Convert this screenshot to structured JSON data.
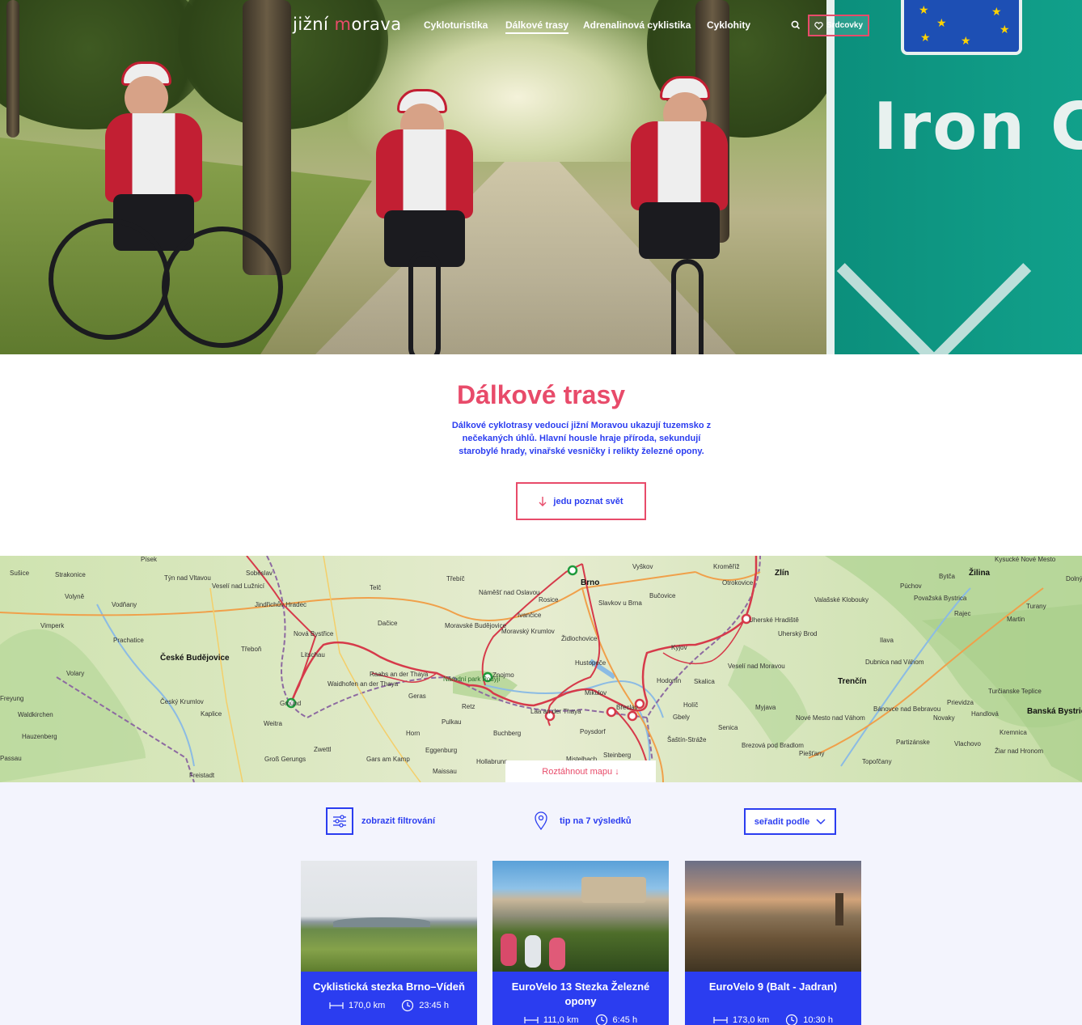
{
  "nav": {
    "logo_prefix": "jižní ",
    "logo_m": "m",
    "logo_suffix": "orava",
    "links": [
      "Cykloturistika",
      "Dálkové trasy",
      "Adrenalinová cyklistika",
      "Cyklohity"
    ],
    "active_index": 1,
    "favorites_label": "Srdcovky"
  },
  "hero": {
    "sign_text": "Iron Cu"
  },
  "intro": {
    "title": "Dálkové trasy",
    "text": "Dálkové cyklotrasy vedoucí jižní Moravou ukazují tuzemsko z nečekaných úhlů. Hlavní housle hraje příroda, sekundují starobylé hrady, vinařské vesničky i relikty železné opony.",
    "cta_label": "jedu poznat svět"
  },
  "map": {
    "toggle_label": "Roztáhnout mapu ↓",
    "cities_major": [
      "České Budějovice",
      "Brno",
      "Zlín",
      "Žilina",
      "Trenčín",
      "Banská Bystric"
    ],
    "places": [
      "Písek",
      "Strakonice",
      "Sušice",
      "Týn nad Vltavou",
      "Veselí nad Lužnicí",
      "Soběslav",
      "Jindřichův Hradec",
      "Volyně",
      "Vodňany",
      "Vimperk",
      "Prachatice",
      "Třeboň",
      "Nová Bystřice",
      "Litschau",
      "Telč",
      "Třebíč",
      "Dačice",
      "Moravské Budějovice",
      "Náměšť nad Oslavou",
      "Moravský Krumlov",
      "Rosice",
      "Ivančice",
      "Vyškov",
      "Slavkov u Brna",
      "Židlochovice",
      "Hustopeče",
      "Mikulov",
      "Břeclav",
      "Hodonín",
      "Kyjov",
      "Bučovice",
      "Kroměříž",
      "Otrokovice",
      "Uherské Hradiště",
      "Uherský Brod",
      "Veselí nad Moravou",
      "Holíč",
      "Skalica",
      "Senica",
      "Myjava",
      "Gbely",
      "Šaštín-Stráže",
      "Poysdorf",
      "Mistelbach",
      "Hollabrunn",
      "Laa an der Thaya",
      "Retz",
      "Znojmo",
      "Pulkau",
      "Horn",
      "Zwettl",
      "Eggenburg",
      "Gars am Kamp",
      "Maissau",
      "Geras",
      "Raabs an der Thaya",
      "Waidhofen an der Thaya",
      "Gmünd",
      "Weitra",
      "Groß Gerungs",
      "Freistadt",
      "Kaplice",
      "Český Krumlov",
      "Volary",
      "Waldkirchen",
      "Hauzenberg",
      "Passau",
      "Freyung",
      "Brezová pod Bradlom",
      "Nové Mesto nad Váhom",
      "Piešťany",
      "Topoľčany",
      "Bánovce nad Bebravou",
      "Partizánske",
      "Prievidza",
      "Handlová",
      "Kremnica",
      "Novaky",
      "Dubnica nad Váhom",
      "Ilava",
      "Valašské Klobouky",
      "Púchov",
      "Považská Bystrica",
      "Bytča",
      "Rajec",
      "Martin",
      "Turany",
      "Kysucké Nové Mesto",
      "Dolný",
      "Turčianske Teplice",
      "Žiar nad Hronom",
      "Vlachovo",
      "Buchberg",
      "Steinberg"
    ],
    "brand_label": "Národní park Podyjí"
  },
  "listing": {
    "filter_label": "zobrazit filtrování",
    "tip_label": "tip na 7 výsledků",
    "sort_label": "seřadit podle",
    "cards": [
      {
        "title": "Cyklistická stezka Brno–Vídeň",
        "distance": "170,0 km",
        "duration": "23:45 h"
      },
      {
        "title": "EuroVelo 13 Stezka Železné opony",
        "distance": "111,0 km",
        "duration": "6:45 h"
      },
      {
        "title": "EuroVelo 9 (Balt - Jadran)",
        "distance": "173,0 km",
        "duration": "10:30 h"
      }
    ]
  },
  "colors": {
    "brand_pink": "#e84b6a",
    "brand_blue": "#2b3df0",
    "listing_bg": "#f3f4fd"
  }
}
